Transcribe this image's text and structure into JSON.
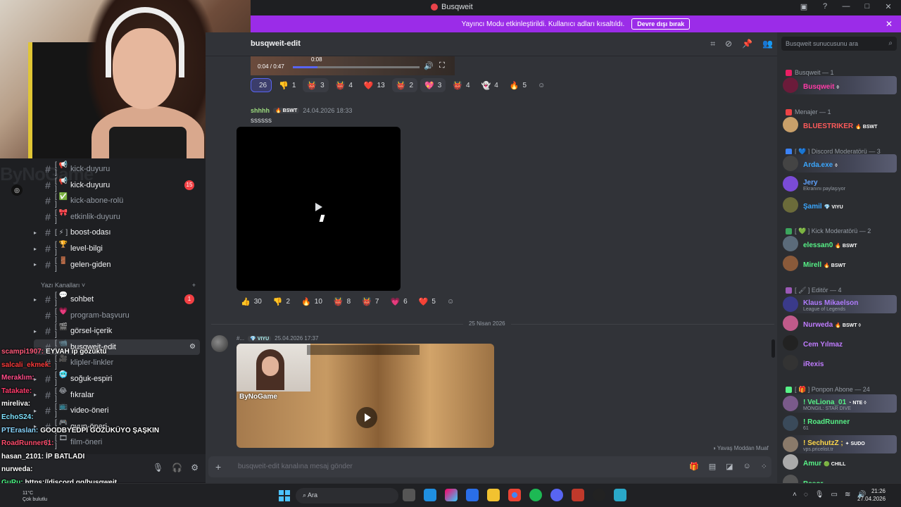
{
  "window": {
    "title": "Busqweit",
    "controls": [
      "▣",
      "?",
      "—",
      "□",
      "✕"
    ]
  },
  "banner": {
    "text": "Yayıncı Modu etkinleştirildi. Kullanıcı adları kısaltıldı.",
    "button": "Devre dışı bırak",
    "close": "✕"
  },
  "brand": {
    "text": "ByNoGame"
  },
  "channels": [
    {
      "emoji": "[ 📢 ]",
      "name": "kick-duyuru",
      "style": "dim",
      "arrow": ""
    },
    {
      "emoji": "[ 📢 ]",
      "name": "kick-duyuru",
      "style": "bright",
      "arrow": "",
      "badge": "15"
    },
    {
      "emoji": "[ ✅ ]",
      "name": "kick-abone-rolü",
      "style": "dim",
      "arrow": ""
    },
    {
      "emoji": "[ 🎀 ]",
      "name": "etkinlik-duyuru",
      "style": "dim",
      "arrow": ""
    },
    {
      "emoji": "[ ⚡ ]",
      "name": "boost-odası",
      "style": "bright",
      "arrow": "▸"
    },
    {
      "emoji": "[ 🏆 ]",
      "name": "level-bilgi",
      "style": "bright",
      "arrow": "▸"
    },
    {
      "emoji": "[ 🚪 ]",
      "name": "gelen-giden",
      "style": "bright",
      "arrow": "▸"
    }
  ],
  "text_section": {
    "label": "Yazı Kanalları ˅",
    "add": "+"
  },
  "channels2": [
    {
      "emoji": "[ 💬 ]",
      "name": "sohbet",
      "style": "bright",
      "arrow": "▸",
      "badge": "1"
    },
    {
      "emoji": "[ 💗 ]",
      "name": "program-başvuru",
      "style": "dim",
      "arrow": ""
    },
    {
      "emoji": "[ 🎬 ]",
      "name": "görsel-içerik",
      "style": "bright",
      "arrow": "▸"
    },
    {
      "emoji": "[ 📹 ]",
      "name": "busqweit-edit",
      "style": "active",
      "arrow": ""
    },
    {
      "emoji": "[ 🎥 ]",
      "name": "klipler-linkler",
      "style": "dim",
      "arrow": ""
    },
    {
      "emoji": "[ 🥶 ]",
      "name": "soğuk-espiri",
      "style": "bright",
      "arrow": "▸"
    },
    {
      "emoji": "[ 😂 ]",
      "name": "fıkralar",
      "style": "bright",
      "arrow": "▸"
    },
    {
      "emoji": "[ 📺 ]",
      "name": "video-öneri",
      "style": "bright",
      "arrow": "▸"
    },
    {
      "emoji": "[ 🎮 ]",
      "name": "oyun-öneri",
      "style": "bright",
      "arrow": "▸"
    },
    {
      "emoji": "[ 🎞 ]",
      "name": "film-öneri",
      "style": "dim",
      "arrow": ""
    }
  ],
  "stream_chat": [
    {
      "user": "scampi1907:",
      "msg": "EYVAH ip gözüktü",
      "color": "#ff5a7a"
    },
    {
      "user": "salcali_ekmek:",
      "msg": "",
      "color": "#ff3b3b"
    },
    {
      "user": "Meraklım:",
      "msg": "",
      "color": "#ff4d8a"
    },
    {
      "user": "Tatakate:",
      "msg": "",
      "color": "#ff3b6b"
    },
    {
      "user": "mireliva:",
      "msg": "",
      "color": "#ffffff"
    },
    {
      "user": "EchoS24:",
      "msg": "",
      "color": "#7fe3ff"
    },
    {
      "user": "PTEraslan:",
      "msg": "GOODBYEDPI GÖZÜKÜYO ŞAŞKIN",
      "color": "#8ad6ff"
    },
    {
      "user": "RoadRunner61:",
      "msg": "",
      "color": "#ff4d6d"
    },
    {
      "user": "hasan_2101:",
      "msg": "İP BATLADI",
      "color": "#ffffff"
    },
    {
      "user": "nurweda:",
      "msg": "",
      "color": "#ffffff"
    },
    {
      "user": "GuRu:",
      "msg": "https://discord.gg/busqweit",
      "color": "#4dff88"
    }
  ],
  "header": {
    "channel": "busqweit-edit",
    "icons": [
      "⌗",
      "⊘",
      "📌",
      "👥"
    ]
  },
  "video1": {
    "current": "0:04 / 0:47",
    "hover": "0:08"
  },
  "reactions1": [
    {
      "e": "",
      "n": "26",
      "kind": "mine"
    },
    {
      "e": "👎",
      "n": "1",
      "kind": ""
    },
    {
      "e": "👹",
      "n": "3",
      "kind": "hl"
    },
    {
      "e": "👹",
      "n": "4",
      "kind": ""
    },
    {
      "e": "❤️",
      "n": "13",
      "kind": ""
    },
    {
      "e": "👹",
      "n": "2",
      "kind": "hl"
    },
    {
      "e": "💖",
      "n": "3",
      "kind": "hl"
    },
    {
      "e": "👹",
      "n": "4",
      "kind": ""
    },
    {
      "e": "👻",
      "n": "4",
      "kind": ""
    },
    {
      "e": "🔥",
      "n": "5",
      "kind": ""
    }
  ],
  "message1": {
    "author": "shhhh",
    "tag": "🔥 BSWT",
    "time": "24.04.2026 18:33",
    "text": "ssssss"
  },
  "reactions2": [
    {
      "e": "👍",
      "n": "30"
    },
    {
      "e": "👎",
      "n": "2"
    },
    {
      "e": "🔥",
      "n": "10"
    },
    {
      "e": "👹",
      "n": "8"
    },
    {
      "e": "👹",
      "n": "7"
    },
    {
      "e": "💗",
      "n": "6"
    },
    {
      "e": "❤️",
      "n": "5"
    }
  ],
  "date_divider": "25 Nisan 2026",
  "message2": {
    "author": "#...",
    "tag": "💎 VIYU",
    "time": "25.04.2026 17:37",
    "clip_label": "ByNoGame"
  },
  "slowmode": "◑ Yavaş Moddan Muaf",
  "composer": {
    "placeholder": "busqweit-edit kanalına mesaj gönder"
  },
  "members_search": "Busqweit sunucusunu ara",
  "member_groups": [
    {
      "label": "Busqweit — 1",
      "color": "#e91e63"
    },
    {
      "label": "Menajer — 1",
      "color": "#ed4245"
    },
    {
      "label": "[ 💙 ] Discord Moderatörü — 3",
      "color": "#3b82f6"
    },
    {
      "label": "[ 💚 ] Kick Moderatörü — 2",
      "color": "#3ba55d"
    },
    {
      "label": "[ 🖌 ] Editör — 4",
      "color": "#9b59b6"
    },
    {
      "label": "[ 🎁 ] Ponpon Abone — 24",
      "color": "#57f287"
    }
  ],
  "members": [
    {
      "name": "Busqweit",
      "sub": "",
      "tag": "◊",
      "color": "#ff3ba7",
      "av": "#6b1b3a"
    },
    {
      "name": "BLUESTRIKER",
      "sub": "",
      "tag": "🔥 BSWT",
      "color": "#ff5a5a",
      "av": "#c9a06a"
    },
    {
      "name": "Arda.exe",
      "sub": "",
      "tag": "◊",
      "color": "#3aa7ff",
      "av": "#444"
    },
    {
      "name": "Jery",
      "sub": "Ekranını paylaşıyor",
      "tag": "",
      "color": "#5fa3ff",
      "av": "#7a4bd6"
    },
    {
      "name": "Şamil",
      "sub": "",
      "tag": "💎 VIYU",
      "color": "#3aa7ff",
      "av": "#6b6b3a"
    },
    {
      "name": "elessan0",
      "sub": "",
      "tag": "🔥 BSWT",
      "color": "#57f287",
      "av": "#5b6b7a"
    },
    {
      "name": "Mirell",
      "sub": "",
      "tag": "🔥 BSWT",
      "color": "#57f287",
      "av": "#8a5a3a"
    },
    {
      "name": "Klaus Mikaelson",
      "sub": "League of Legends",
      "tag": "",
      "color": "#b07cff",
      "av": "#3a3a8a"
    },
    {
      "name": "Nurweda",
      "sub": "",
      "tag": "🔥 BSWT ◊",
      "color": "#c07cff",
      "av": "#c05a8a"
    },
    {
      "name": "Cem Yılmaz",
      "sub": "",
      "tag": "",
      "color": "#c07cff",
      "av": "#222"
    },
    {
      "name": "iRexis",
      "sub": "",
      "tag": "",
      "color": "#c07cff",
      "av": "#333"
    },
    {
      "name": "! VeLiona_01",
      "sub": "MONGIL: STAR DIVE",
      "tag": "◔ NTE ◊",
      "color": "#57f287",
      "av": "#7a5a8a"
    },
    {
      "name": "! RoadRunner",
      "sub": "61",
      "tag": "",
      "color": "#57f287",
      "av": "#3a4a5a"
    },
    {
      "name": "! SechutzZ ;",
      "sub": "vps.pricelist.tr",
      "tag": "✦ SUDO",
      "color": "#ffd84a",
      "av": "#8a7a6a"
    },
    {
      "name": "Amur",
      "sub": "",
      "tag": "🟢 CHILL",
      "color": "#57f287",
      "av": "#aaa"
    },
    {
      "name": "Basor",
      "sub": "",
      "tag": "",
      "color": "#57f287",
      "av": "#555"
    }
  ],
  "taskbar": {
    "weather_temp": "11°C",
    "weather_desc": "Çok bulutlu",
    "search": "Ara",
    "time": "21:26",
    "date": "27.04.2026"
  }
}
